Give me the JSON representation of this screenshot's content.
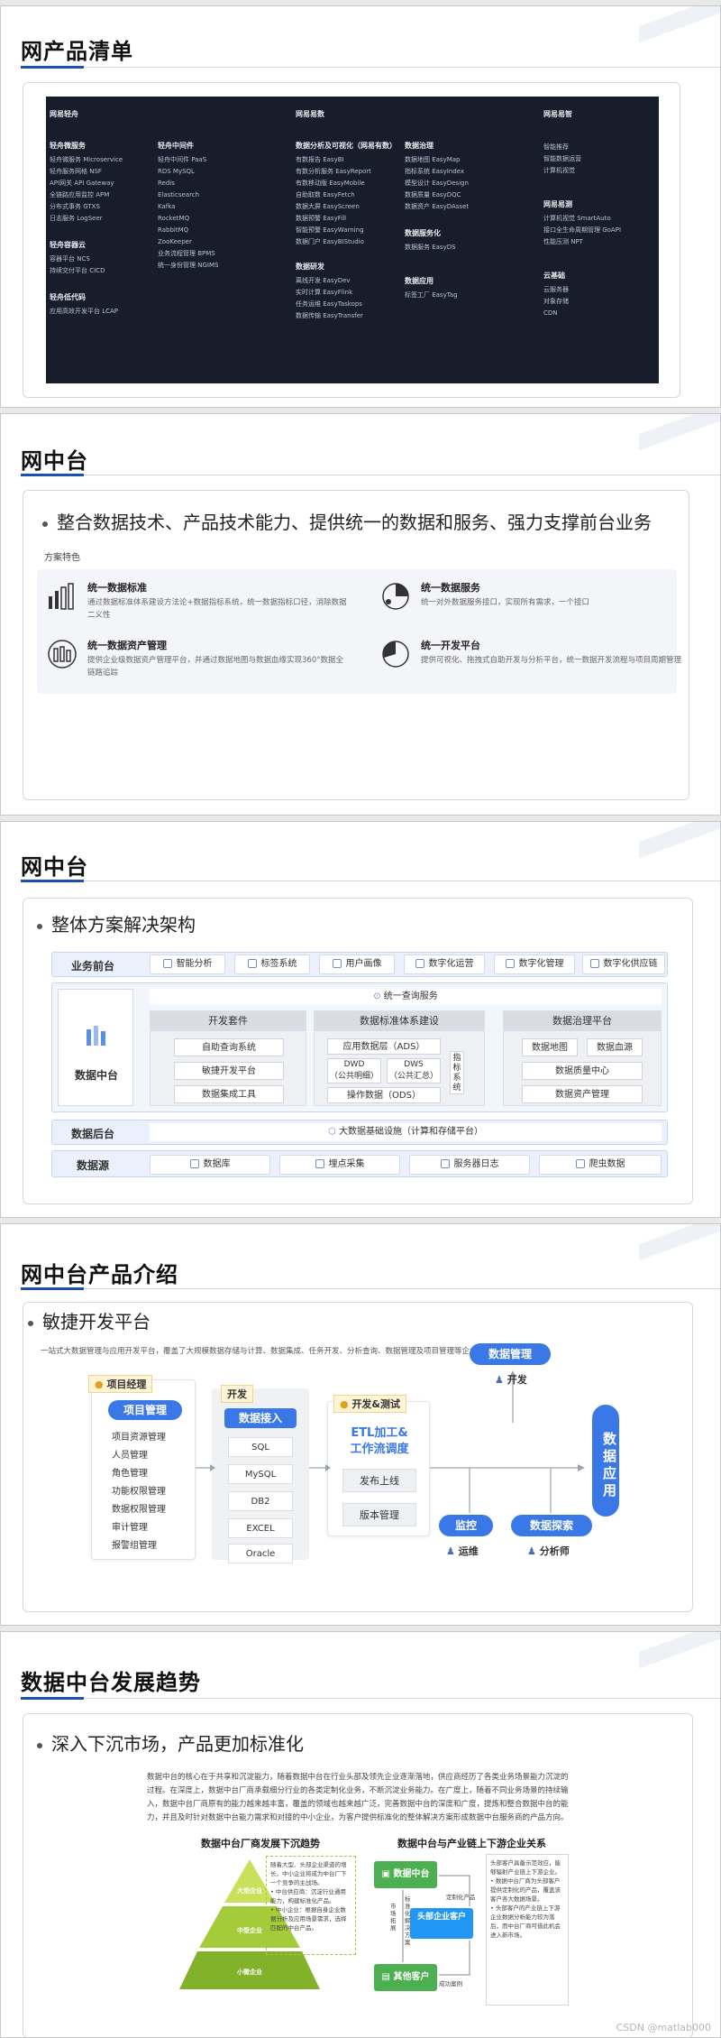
{
  "slide1": {
    "title": "网产品清单",
    "nav": {
      "headers": [
        "网易轻舟",
        "网易易数",
        "网易易智"
      ],
      "col1": {
        "title": "轻舟微服务",
        "items": [
          "轻舟微服务 Microservice",
          "轻舟服务网格 NSF",
          "API网关 API Gateway",
          "全链路应用监控 APM",
          "分布式事务 GTXS",
          "日志服务 LogSeer"
        ]
      },
      "col1b": {
        "title": "轻舟容器云",
        "items": [
          "容器平台 NCS",
          "持续交付平台 CICD"
        ]
      },
      "col1c": {
        "title": "轻舟低代码",
        "items": [
          "应用高效开发平台 LCAP"
        ]
      },
      "col2": {
        "title": "轻舟中间件",
        "items": [
          "轻舟中间件 PaaS",
          "RDS MySQL",
          "Redis",
          "Elasticsearch",
          "Kafka",
          "RocketMQ",
          "RabbitMQ",
          "ZooKeeper",
          "业务流程管理 BPMS",
          "统一身份管理 NGIMS"
        ]
      },
      "col3": {
        "title": "数据分析及可视化（网易有数）",
        "items": [
          "有数报告 EasyBI",
          "有数分析服务 EasyReport",
          "有数移动版 EasyMobile",
          "自助取数 EasyFetch",
          "数据大屏 EasyScreen",
          "数据预警 EasyFill",
          "智能预警 EasyWarning",
          "数据门户 EasyBIStudio"
        ]
      },
      "col3b": {
        "title": "数据研发",
        "items": [
          "离线开发 EasyDev",
          "实时计算 EasyFlink",
          "任务运维 EasyTaskops",
          "数据传输 EasyTransfer"
        ]
      },
      "col4": {
        "title": "数据治理",
        "items": [
          "数据地图 EasyMap",
          "指标系统 EasyIndex",
          "模型设计 EasyDesign",
          "数据质量 EasyDQC",
          "数据资产 EasyDAsset"
        ]
      },
      "col4b": {
        "title": "数据服务化",
        "items": [
          "数据服务 EasyDS"
        ]
      },
      "col4c": {
        "title": "数据应用",
        "items": [
          "标签工厂 EasyTag"
        ]
      },
      "col5": {
        "title": "",
        "items": [
          "智能推荐",
          "智能数据运营",
          "计算机视觉"
        ]
      },
      "col5b": {
        "title": "网易易测",
        "items": [
          "计算机视觉 SmartAuto",
          "接口全生命周期管理 GoAPI",
          "性能压测 NPT"
        ]
      },
      "col5c": {
        "title": "云基础",
        "items": [
          "云服务器",
          "对象存储",
          "CDN"
        ]
      }
    }
  },
  "slide2": {
    "title": "网中台",
    "bullet": "整合数据技术、产品技术能力、提供统一的数据和服务、强力支撑前台业务",
    "section": "方案特色",
    "features": [
      {
        "title": "统一数据标准",
        "desc": "通过数据标准体系建设方法论+数据指标系统，统一数据指标口径，消除数据二义性"
      },
      {
        "title": "统一数据服务",
        "desc": "统一对外数据服务接口，实现所有需求，一个接口"
      },
      {
        "title": "统一数据资产管理",
        "desc": "提供企业级数据资产管理平台，并通过数据地图与数据血缘实现360°数据全链路追踪"
      },
      {
        "title": "统一开发平台",
        "desc": "提供可视化、拖拽式自助开发与分析平台，统一数据开发流程与项目周期管理"
      }
    ]
  },
  "slide3": {
    "title": "网中台",
    "bullet": "整体方案解决架构",
    "rows": {
      "front": {
        "label": "业务前台",
        "chips": [
          "智能分析",
          "标签系统",
          "用户画像",
          "数字化运营",
          "数字化管理",
          "数字化供应链"
        ]
      },
      "middle": {
        "label": "数据中台",
        "query": "统一查询服务",
        "dev": {
          "head": "开发套件",
          "items": [
            "自助查询系统",
            "敏捷开发平台",
            "数据集成工具"
          ]
        },
        "std": {
          "head": "数据标准体系建设",
          "ads": "应用数据层（ADS）",
          "dwd": "DWD\n（公共明细）",
          "dws": "DWS\n（公共汇总）",
          "ods": "操作数据（ODS）",
          "metric": "指标系统"
        },
        "gov": {
          "head": "数据治理平台",
          "items": [
            "数据地图",
            "数据血源",
            "数据质量中心",
            "数据资产管理"
          ]
        }
      },
      "back": {
        "label": "数据后台",
        "text": "大数据基础设施（计算和存储平台）"
      },
      "source": {
        "label": "数据源",
        "chips": [
          "数据库",
          "埋点采集",
          "服务器日志",
          "爬虫数据"
        ]
      }
    }
  },
  "slide4": {
    "title": "网中台产品介绍",
    "bullet": "敏捷开发平台",
    "desc": "一站式大数据管理与应用开发平台，覆盖了大规模数据存储与计算、数据集成、任务开发、分析查询、数据管理及项目管理等企业级大数据应用场景。",
    "pm": {
      "tag": "项目经理",
      "pill": "项目管理",
      "items": [
        "项目资源管理",
        "人员管理",
        "角色管理",
        "功能权限管理",
        "数据权限管理",
        "审计管理",
        "报警组管理"
      ]
    },
    "dev": {
      "tag": "开发",
      "pill": "数据接入",
      "items": [
        "SQL",
        "MySQL",
        "DB2",
        "EXCEL",
        "Oracle"
      ]
    },
    "test": {
      "tag": "开发&测试",
      "head": "ETL加工&\n工作流调度",
      "items": [
        "发布上线",
        "版本管理"
      ]
    },
    "dm": {
      "pill": "数据管理",
      "role": "开发"
    },
    "mon": {
      "pill": "监控",
      "role": "运维"
    },
    "explore": {
      "pill": "数据探索",
      "role": "分析师"
    },
    "app": "数据应用"
  },
  "slide5": {
    "title": "数据中台发展趋势",
    "bullet": "深入下沉市场，产品更加标准化",
    "para": "数据中台的核心在于共享和沉淀能力，随着数据中台在行业头部及领先企业逐渐落地，供应商经历了各类业务场景能力沉淀的过程。在深度上，数据中台厂商承载细分行业的各类定制化业务，不断沉淀业务能力。在广度上，随着不同业务场景的持续输入，数据中台厂商原有的能力越来越丰富，覆盖的领域也越来越广泛，完善数据中台的深度和广度，提炼和整合数据中台的能力，并且及时针对数据中台能力需求和对接的中小企业，为客户提供标准化的整体解决方案形成数据中台服务商的产品方向。",
    "left": {
      "title": "数据中台厂商发展下沉趋势",
      "levels": [
        "大型企业",
        "中型企业",
        "小微企业"
      ],
      "note": "随着大型、头部企业渠道的增长，中小企业将成为中台厂下一个竞争的主战场。\n• 中台供应商：沉淀行业通用能力，构建标准化产品。\n• 中小企业：根据自身企业数据分析及应用场景需求，选择匹配的中台产品。"
    },
    "right": {
      "title": "数据中台与产业链上下游企业关系",
      "vendor": "数据中台",
      "buyer": "头部企业客户",
      "other": "其他客户",
      "labels": [
        "市场拓展",
        "标准化解决方案",
        "定制化产品",
        "成功案例"
      ],
      "note": "头部客户具备示范效应，能够辐射产业链上下游企业。\n• 数据中台厂商为头部客户提供定制化的产品，覆盖该客户各大数据场景。\n• 头部客户的产业链上下游企业数据分析能力较为落后，而中台厂商可借此机会进入新市场。"
    },
    "watermark": "CSDN @matlab000"
  }
}
